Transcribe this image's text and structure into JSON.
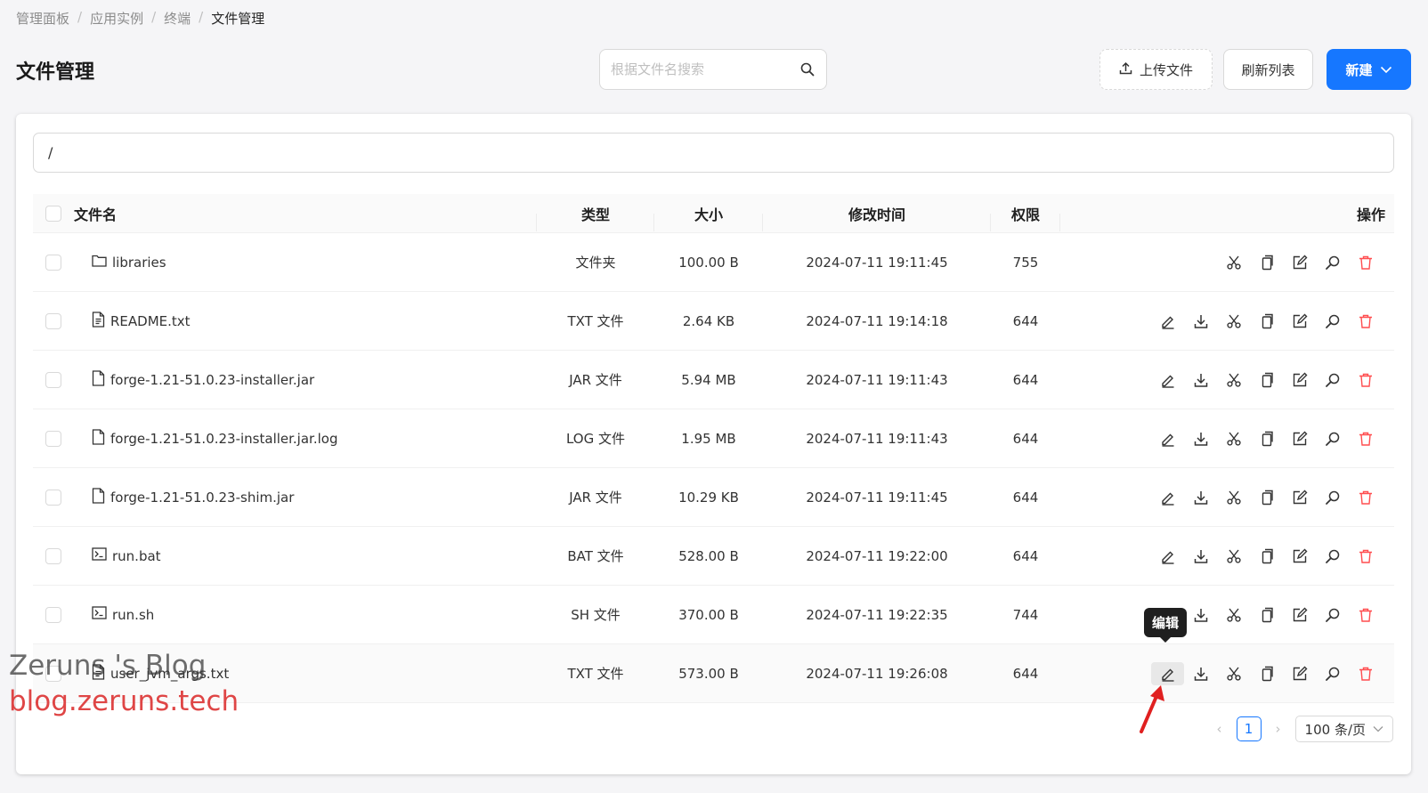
{
  "breadcrumb": [
    "管理面板",
    "应用实例",
    "终端",
    "文件管理"
  ],
  "page_title": "文件管理",
  "search": {
    "placeholder": "根据文件名搜索"
  },
  "toolbar": {
    "upload_label": "上传文件",
    "refresh_label": "刷新列表",
    "new_label": "新建"
  },
  "path": "/",
  "table": {
    "headers": {
      "name": "文件名",
      "type": "类型",
      "size": "大小",
      "mtime": "修改时间",
      "perm": "权限",
      "ops": "操作"
    },
    "rows": [
      {
        "name": "libraries",
        "icon": "folder-icon",
        "type": "文件夹",
        "size": "100.00 B",
        "mtime": "2024-07-11 19:11:45",
        "perm": "755"
      },
      {
        "name": "README.txt",
        "icon": "text-file-icon",
        "type": "TXT 文件",
        "size": "2.64 KB",
        "mtime": "2024-07-11 19:14:18",
        "perm": "644"
      },
      {
        "name": "forge-1.21-51.0.23-installer.jar",
        "icon": "file-icon",
        "type": "JAR 文件",
        "size": "5.94 MB",
        "mtime": "2024-07-11 19:11:43",
        "perm": "644"
      },
      {
        "name": "forge-1.21-51.0.23-installer.jar.log",
        "icon": "file-icon",
        "type": "LOG 文件",
        "size": "1.95 MB",
        "mtime": "2024-07-11 19:11:43",
        "perm": "644"
      },
      {
        "name": "forge-1.21-51.0.23-shim.jar",
        "icon": "file-icon",
        "type": "JAR 文件",
        "size": "10.29 KB",
        "mtime": "2024-07-11 19:11:45",
        "perm": "644"
      },
      {
        "name": "run.bat",
        "icon": "terminal-file-icon",
        "type": "BAT 文件",
        "size": "528.00 B",
        "mtime": "2024-07-11 19:22:00",
        "perm": "644"
      },
      {
        "name": "run.sh",
        "icon": "terminal-file-icon",
        "type": "SH 文件",
        "size": "370.00 B",
        "mtime": "2024-07-11 19:22:35",
        "perm": "744"
      },
      {
        "name": "user_jvm_args.txt",
        "icon": "text-file-icon",
        "type": "TXT 文件",
        "size": "573.00 B",
        "mtime": "2024-07-11 19:26:08",
        "perm": "644"
      }
    ]
  },
  "tooltip": "编辑",
  "pagination": {
    "current": "1",
    "page_size": "100 条/页"
  },
  "watermark": {
    "line1": "Zeruns 's Blog",
    "line2": "blog.zeruns.tech"
  },
  "colors": {
    "primary": "#1677ff",
    "danger": "#ff4d4f",
    "annotation_arrow": "#e02020"
  }
}
